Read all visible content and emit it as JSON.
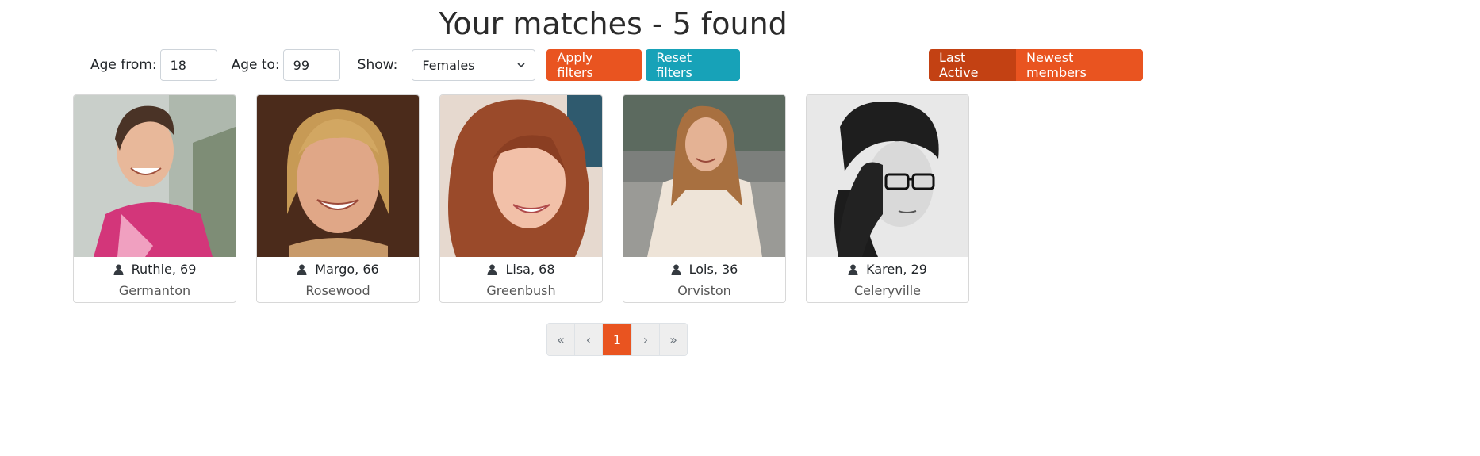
{
  "header": {
    "title": "Your matches - 5 found"
  },
  "filters": {
    "age_from_label": "Age from:",
    "age_from_value": "18",
    "age_to_label": "Age to:",
    "age_to_value": "99",
    "show_label": "Show:",
    "show_value": "Females",
    "apply_label": "Apply filters",
    "reset_label": "Reset filters"
  },
  "sort": {
    "last_active_label": "Last Active",
    "newest_label": "Newest members"
  },
  "matches": [
    {
      "name": "Ruthie, 69",
      "city": "Germanton"
    },
    {
      "name": "Margo, 66",
      "city": "Rosewood"
    },
    {
      "name": "Lisa, 68",
      "city": "Greenbush"
    },
    {
      "name": "Lois, 36",
      "city": "Orviston"
    },
    {
      "name": "Karen, 29",
      "city": "Celeryville"
    }
  ],
  "pagination": {
    "first": "«",
    "prev": "‹",
    "current": "1",
    "next": "›",
    "last": "»"
  },
  "colors": {
    "primary": "#e95420",
    "primary_dark": "#c34113",
    "info": "#17a2b8"
  }
}
